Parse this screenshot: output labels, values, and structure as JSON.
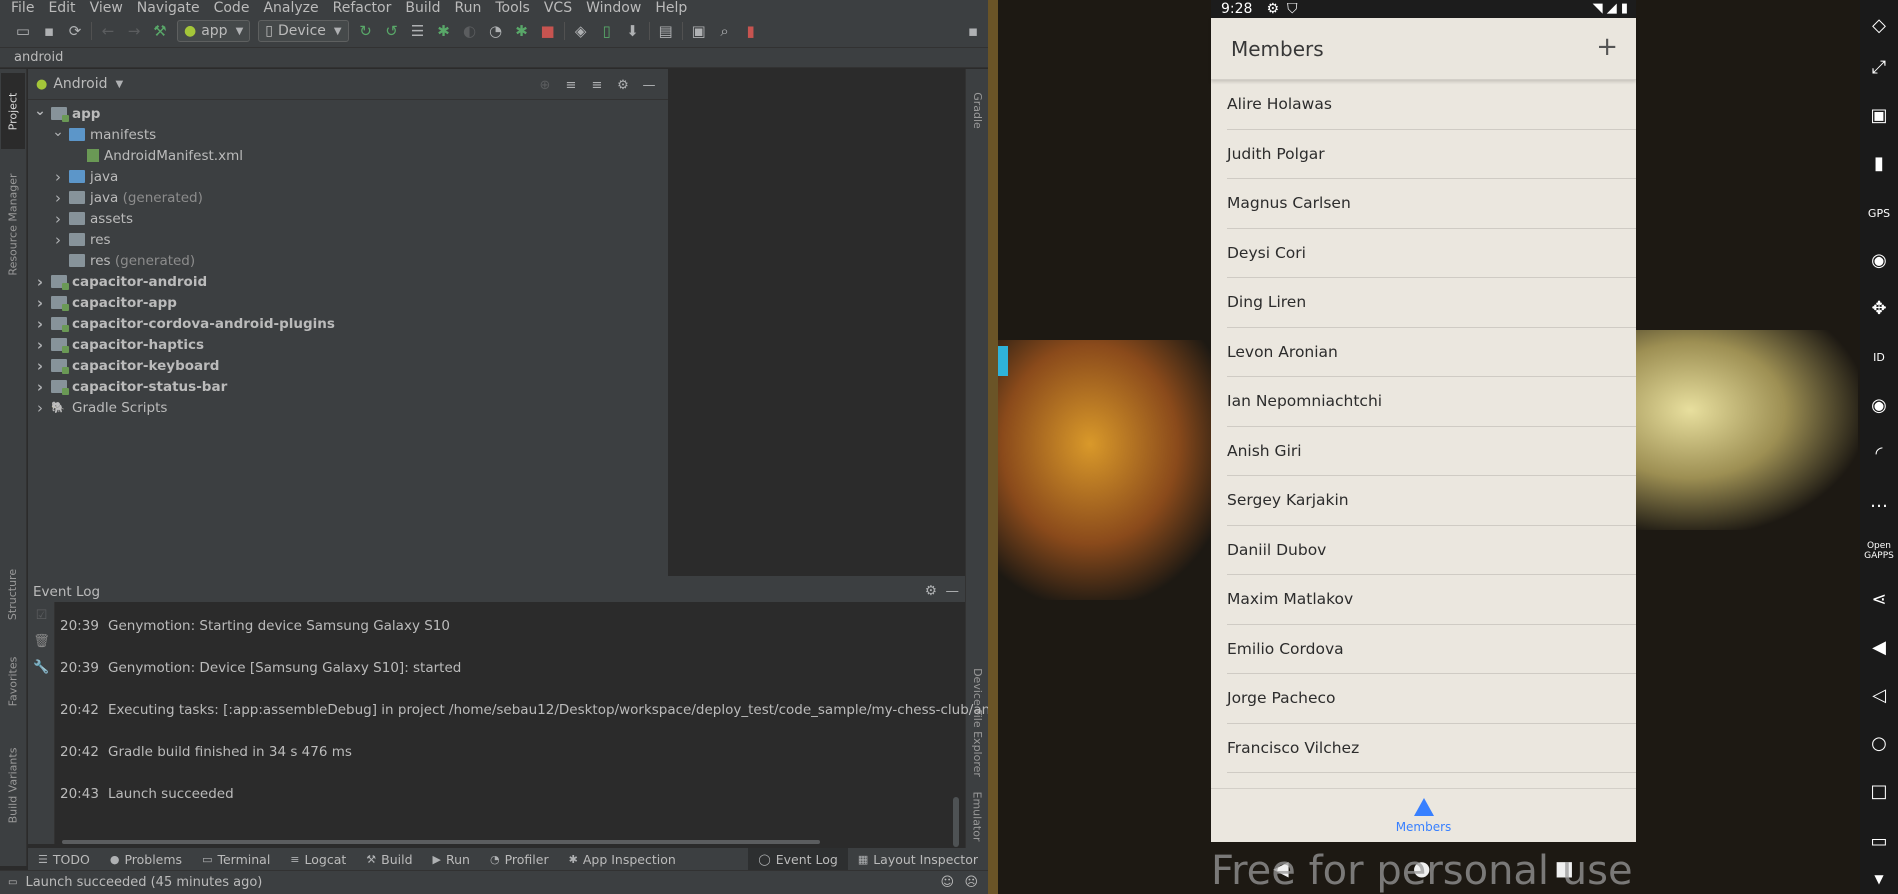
{
  "menu": [
    "File",
    "Edit",
    "View",
    "Navigate",
    "Code",
    "Analyze",
    "Refactor",
    "Build",
    "Run",
    "Tools",
    "VCS",
    "Window",
    "Help"
  ],
  "toolbar": {
    "run_config": "app",
    "device": "Device"
  },
  "breadcrumb": "android",
  "left_tabs": {
    "project": "Project",
    "resource_manager": "Resource Manager",
    "structure": "Structure",
    "favorites": "Favorites",
    "build_variants": "Build Variants"
  },
  "right_tabs": {
    "gradle": "Gradle",
    "device_file_explorer": "Device File Explorer",
    "emulator": "Emulator"
  },
  "project_panel": {
    "view_mode": "Android",
    "tree": [
      {
        "label": "app",
        "suffix": "",
        "level": 0,
        "expanded": true,
        "bold": true,
        "icon": "folder-module"
      },
      {
        "label": "manifests",
        "suffix": "",
        "level": 1,
        "expanded": true,
        "bold": false,
        "icon": "folder-blue"
      },
      {
        "label": "AndroidManifest.xml",
        "suffix": "",
        "level": 2,
        "expanded": null,
        "bold": false,
        "icon": "manifest-file"
      },
      {
        "label": "java",
        "suffix": "",
        "level": 1,
        "expanded": false,
        "bold": false,
        "icon": "folder-blue"
      },
      {
        "label": "java",
        "suffix": " (generated)",
        "level": 1,
        "expanded": false,
        "bold": false,
        "icon": "folder-gen"
      },
      {
        "label": "assets",
        "suffix": "",
        "level": 1,
        "expanded": false,
        "bold": false,
        "icon": "folder"
      },
      {
        "label": "res",
        "suffix": "",
        "level": 1,
        "expanded": false,
        "bold": false,
        "icon": "folder"
      },
      {
        "label": "res",
        "suffix": " (generated)",
        "level": 1,
        "expanded": null,
        "bold": false,
        "icon": "folder-gen"
      },
      {
        "label": "capacitor-android",
        "suffix": "",
        "level": 0,
        "expanded": false,
        "bold": true,
        "icon": "folder-module"
      },
      {
        "label": "capacitor-app",
        "suffix": "",
        "level": 0,
        "expanded": false,
        "bold": true,
        "icon": "folder-module"
      },
      {
        "label": "capacitor-cordova-android-plugins",
        "suffix": "",
        "level": 0,
        "expanded": false,
        "bold": true,
        "icon": "folder-module"
      },
      {
        "label": "capacitor-haptics",
        "suffix": "",
        "level": 0,
        "expanded": false,
        "bold": true,
        "icon": "folder-module"
      },
      {
        "label": "capacitor-keyboard",
        "suffix": "",
        "level": 0,
        "expanded": false,
        "bold": true,
        "icon": "folder-module"
      },
      {
        "label": "capacitor-status-bar",
        "suffix": "",
        "level": 0,
        "expanded": false,
        "bold": true,
        "icon": "folder-module"
      },
      {
        "label": "Gradle Scripts",
        "suffix": "",
        "level": 0,
        "expanded": false,
        "bold": false,
        "icon": "gradle"
      }
    ]
  },
  "event_log": {
    "title": "Event Log",
    "entries": [
      {
        "time": "20:39",
        "message": "Genymotion: Starting device Samsung Galaxy S10"
      },
      {
        "time": "20:39",
        "message": "Genymotion: Device [Samsung Galaxy S10]: started"
      },
      {
        "time": "20:42",
        "message": "Executing tasks: [:app:assembleDebug] in project /home/sebau12/Desktop/workspace/deploy_test/code_sample/my-chess-club/and"
      },
      {
        "time": "20:42",
        "message": "Gradle build finished in 34 s 476 ms"
      },
      {
        "time": "20:43",
        "message": "Launch succeeded"
      }
    ]
  },
  "bottom_tabs": [
    {
      "label": "TODO",
      "icon": "list-icon",
      "active": false
    },
    {
      "label": "Problems",
      "icon": "problems-icon",
      "active": false
    },
    {
      "label": "Terminal",
      "icon": "terminal-icon",
      "active": false
    },
    {
      "label": "Logcat",
      "icon": "logcat-icon",
      "active": false
    },
    {
      "label": "Build",
      "icon": "hammer-icon",
      "active": false
    },
    {
      "label": "Run",
      "icon": "run-icon",
      "active": false
    },
    {
      "label": "Profiler",
      "icon": "profiler-icon",
      "active": false
    },
    {
      "label": "App Inspection",
      "icon": "inspection-icon",
      "active": false
    },
    {
      "label": "Event Log",
      "icon": "event-log-icon",
      "active": true
    },
    {
      "label": "Layout Inspector",
      "icon": "layout-inspector-icon",
      "active": false
    }
  ],
  "status_bar": {
    "message": "Launch succeeded (45 minutes ago)"
  },
  "phone": {
    "time": "9:28",
    "app_title": "Members",
    "add_label": "+",
    "members": [
      "Alire Holawas",
      "Judith Polgar",
      "Magnus Carlsen",
      "Deysi Cori",
      "Ding Liren",
      "Levon Aronian",
      "Ian Nepomniachtchi",
      "Anish Giri",
      "Sergey Karjakin",
      "Daniil Dubov",
      "Maxim Matlakov",
      "Emilio Cordova",
      "Jorge Pacheco",
      "Francisco Vilchez"
    ],
    "tab_label": "Members",
    "accent": "#3880ff"
  },
  "watermark": "Free for personal use",
  "emulator_panel": {
    "gps": "GPS",
    "open_gapps": "Open GAPPS"
  }
}
